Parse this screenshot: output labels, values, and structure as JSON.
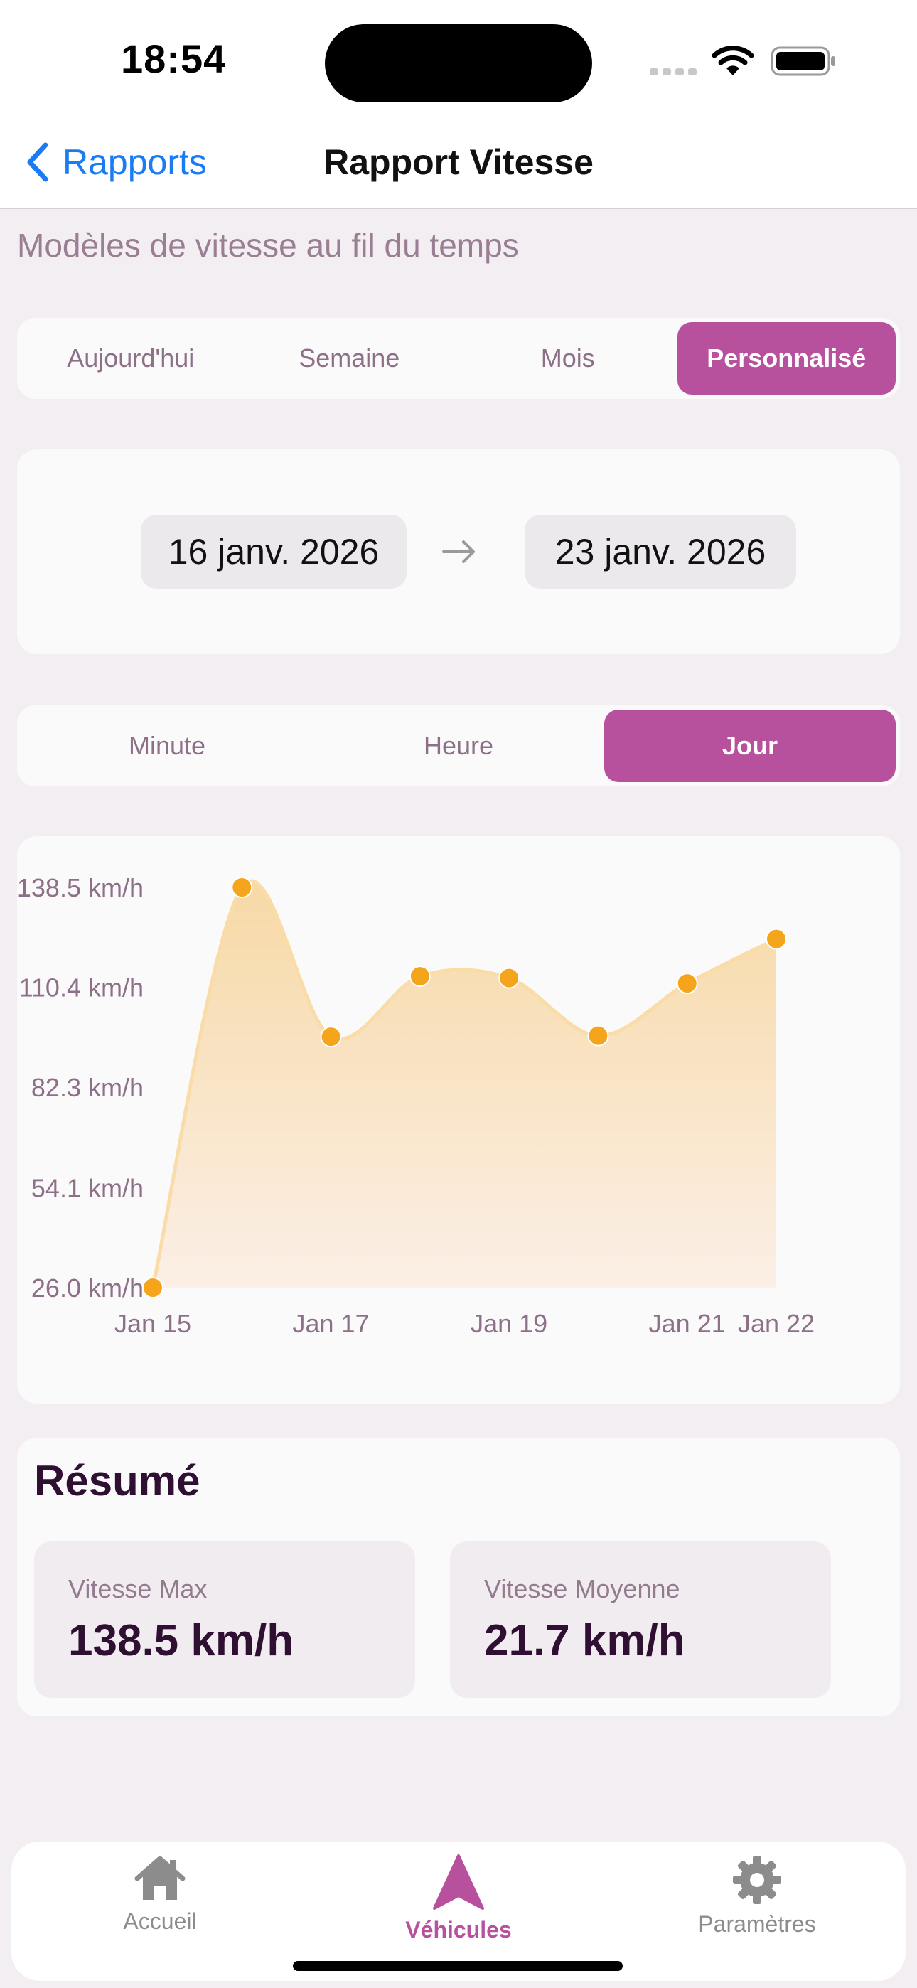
{
  "status_bar": {
    "time": "18:54"
  },
  "nav": {
    "back_label": "Rapports",
    "title": "Rapport Vitesse"
  },
  "subtitle": "Modèles de vitesse au fil du temps",
  "period_tabs": [
    {
      "label": "Aujourd'hui",
      "active": false
    },
    {
      "label": "Semaine",
      "active": false
    },
    {
      "label": "Mois",
      "active": false
    },
    {
      "label": "Personnalisé",
      "active": true
    }
  ],
  "date_range": {
    "start": "16 janv. 2026",
    "end": "23 janv. 2026"
  },
  "granularity_tabs": [
    {
      "label": "Minute",
      "active": false
    },
    {
      "label": "Heure",
      "active": false
    },
    {
      "label": "Jour",
      "active": true
    }
  ],
  "chart_data": {
    "type": "area",
    "series": [
      {
        "x": [
          "Jan 15",
          "Jan 16",
          "Jan 17",
          "Jan 18",
          "Jan 19",
          "Jan 20",
          "Jan 21",
          "Jan 22"
        ],
        "values": [
          26.0,
          138.5,
          96.5,
          113.5,
          113.0,
          96.8,
          111.5,
          124.0
        ]
      }
    ],
    "y_ticks": [
      "138.5 km/h",
      "110.4 km/h",
      "82.3 km/h",
      "54.1 km/h",
      "26.0 km/h"
    ],
    "y_tick_values": [
      138.5,
      110.4,
      82.3,
      54.1,
      26.0
    ],
    "ylim": [
      26.0,
      138.5
    ],
    "x_tick_labels": [
      "Jan 15",
      "Jan 17",
      "Jan 19",
      "Jan 21",
      "Jan 22"
    ],
    "x_tick_indices": [
      0,
      2,
      4,
      6,
      7
    ],
    "grid": false,
    "colors": {
      "line": "#f9dca8",
      "fill_top": "#f7d9a6",
      "fill_bottom": "#fbefe6",
      "point": "#f4a51c"
    }
  },
  "summary": {
    "title": "Résumé",
    "max_label": "Vitesse Max",
    "max_value": "138.5 km/h",
    "avg_label": "Vitesse Moyenne",
    "avg_value": "21.7 km/h"
  },
  "tab_bar": {
    "items": [
      {
        "label": "Accueil",
        "icon": "house-icon",
        "active": false
      },
      {
        "label": "Véhicules",
        "icon": "navigation-arrow-icon",
        "active": true
      },
      {
        "label": "Paramètres",
        "icon": "gear-icon",
        "active": false
      }
    ]
  },
  "colors": {
    "accent": "#b8519d",
    "link": "#1a7cf5",
    "background": "#f3eef2"
  }
}
